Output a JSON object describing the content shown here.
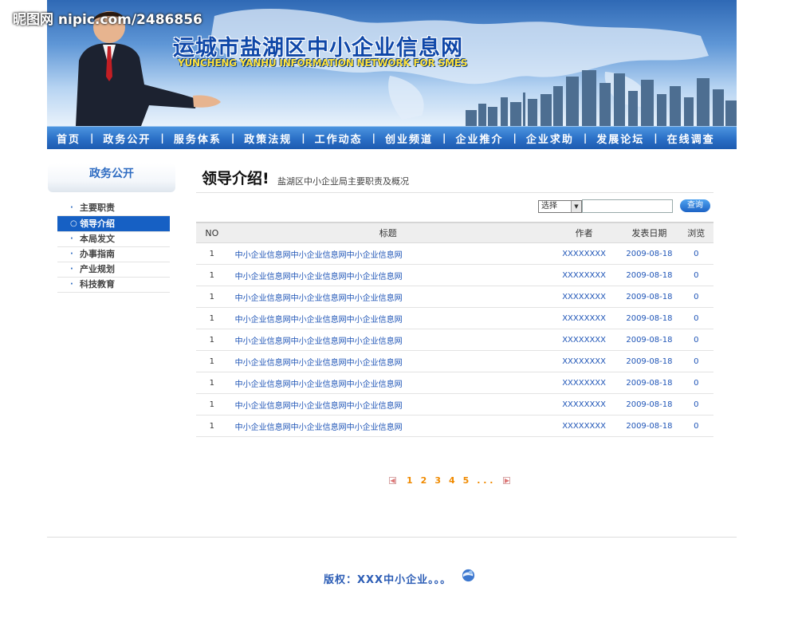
{
  "watermark": "昵图网 nipic.com/2486856",
  "header": {
    "title": "运城市盐湖区中小企业信息网",
    "subtitle": "YUNCHENG YANHU INFORMATION NETWORK FOR SMES"
  },
  "nav": {
    "items": [
      "首页",
      "政务公开",
      "服务体系",
      "政策法规",
      "工作动态",
      "创业频道",
      "企业推介",
      "企业求助",
      "发展论坛",
      "在线调查"
    ],
    "separator": "|"
  },
  "sidebar": {
    "title": "政务公开",
    "items": [
      {
        "label": "主要职责",
        "active": false
      },
      {
        "label": "领导介绍",
        "active": true
      },
      {
        "label": "本局发文",
        "active": false
      },
      {
        "label": "办事指南",
        "active": false
      },
      {
        "label": "产业规划",
        "active": false
      },
      {
        "label": "科技教育",
        "active": false
      }
    ]
  },
  "main": {
    "heading": "领导介绍!",
    "subheading": "盐湖区中小企业局主要职责及概况",
    "search": {
      "select_value": "选择",
      "button": "查询",
      "input_value": ""
    },
    "table": {
      "headers": [
        "NO",
        "标题",
        "作者",
        "发表日期",
        "浏览"
      ],
      "rows": [
        [
          "1",
          "中小企业信息网中小企业信息网中小企业信息网",
          "XXXXXXXX",
          "2009-08-18",
          "0"
        ],
        [
          "1",
          "中小企业信息网中小企业信息网中小企业信息网",
          "XXXXXXXX",
          "2009-08-18",
          "0"
        ],
        [
          "1",
          "中小企业信息网中小企业信息网中小企业信息网",
          "XXXXXXXX",
          "2009-08-18",
          "0"
        ],
        [
          "1",
          "中小企业信息网中小企业信息网中小企业信息网",
          "XXXXXXXX",
          "2009-08-18",
          "0"
        ],
        [
          "1",
          "中小企业信息网中小企业信息网中小企业信息网",
          "XXXXXXXX",
          "2009-08-18",
          "0"
        ],
        [
          "1",
          "中小企业信息网中小企业信息网中小企业信息网",
          "XXXXXXXX",
          "2009-08-18",
          "0"
        ],
        [
          "1",
          "中小企业信息网中小企业信息网中小企业信息网",
          "XXXXXXXX",
          "2009-08-18",
          "0"
        ],
        [
          "1",
          "中小企业信息网中小企业信息网中小企业信息网",
          "XXXXXXXX",
          "2009-08-18",
          "0"
        ],
        [
          "1",
          "中小企业信息网中小企业信息网中小企业信息网",
          "XXXXXXXX",
          "2009-08-18",
          "0"
        ]
      ]
    },
    "pagination": {
      "pages": [
        "1",
        "2",
        "3",
        "4",
        "5"
      ],
      "ellipsis": ". . .",
      "prev_icon": "prev-arrow-icon",
      "next_icon": "next-arrow-icon"
    }
  },
  "footer": {
    "text": "版权：XXX中小企业。。。",
    "icon": "globe-icon"
  },
  "colors": {
    "nav": "#2a6fc6",
    "accent": "#1660c4",
    "link": "#1f55b7",
    "pager": "#f08a00"
  }
}
